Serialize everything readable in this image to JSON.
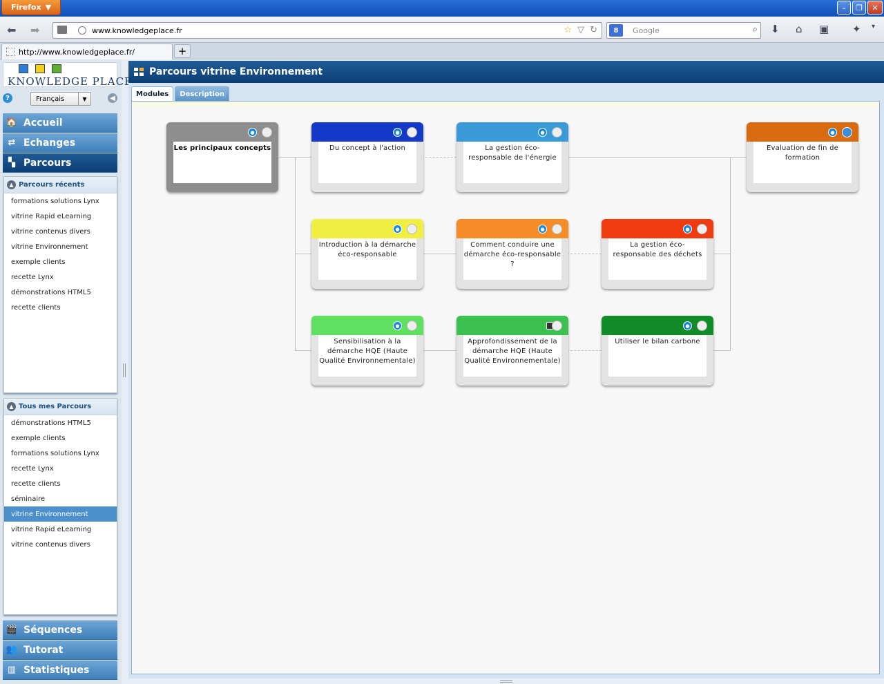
{
  "browser": {
    "menu_label": "Firefox",
    "url": "www.knowledgeplace.fr",
    "search_placeholder": "Google",
    "search_engine_icon": "google-icon",
    "tab_title": "http://www.knowledgeplace.fr/"
  },
  "app": {
    "logo_text": "KNOWLEDGE PLACE",
    "language": "Français",
    "menu": [
      {
        "label": "Accueil",
        "icon": "home-icon"
      },
      {
        "label": "Echanges",
        "icon": "exchange-icon"
      },
      {
        "label": "Parcours",
        "icon": "parcours-icon"
      }
    ],
    "recent": {
      "title": "Parcours récents",
      "items": [
        "formations solutions Lynx",
        "vitrine Rapid eLearning",
        "vitrine contenus divers",
        "vitrine Environnement",
        "exemple clients",
        "recette Lynx",
        "démonstrations HTML5",
        "recette clients"
      ]
    },
    "all": {
      "title": "Tous mes Parcours",
      "items": [
        "démonstrations HTML5",
        "exemple clients",
        "formations solutions Lynx",
        "recette Lynx",
        "recette clients",
        "séminaire",
        "vitrine Environnement",
        "vitrine Rapid eLearning",
        "vitrine contenus divers"
      ],
      "selected_index": 6
    },
    "bottom_menu": [
      {
        "label": "Séquences",
        "icon": "sequences-icon"
      },
      {
        "label": "Tutorat",
        "icon": "tutorat-icon"
      },
      {
        "label": "Statistiques",
        "icon": "statistics-icon"
      }
    ]
  },
  "main": {
    "title": "Parcours vitrine Environnement",
    "tabs": [
      "Modules",
      "Description"
    ],
    "active_tab": "Modules",
    "modules": [
      {
        "label": "Les principaux concepts",
        "color": "#8e8e8e",
        "status": "user"
      },
      {
        "label": "Du concept à l'action",
        "color": "#1438c8",
        "status": "user"
      },
      {
        "label": "La gestion éco-responsable de l'énergie",
        "color": "#3a9ad8",
        "status": "user"
      },
      {
        "label": "Evaluation de fin de formation",
        "color": "#d86a10",
        "status": "user"
      },
      {
        "label": "Introduction à la démarche éco-responsable",
        "color": "#f0ee40",
        "status": "user"
      },
      {
        "label": "Comment conduire une démarche éco-responsable ?",
        "color": "#f58c28",
        "status": "user"
      },
      {
        "label": "La gestion éco-responsable des déchets",
        "color": "#f03a10",
        "status": "user"
      },
      {
        "label": "Sensibilisation à la démarche HQE (Haute Qualité Environnementale)",
        "color": "#60e060",
        "status": "user"
      },
      {
        "label": "Approfondissement de la démarche HQE (Haute Qualité Environnementale)",
        "color": "#3cc050",
        "status": "locked"
      },
      {
        "label": "Utiliser le bilan carbone",
        "color": "#128c28",
        "status": "user"
      }
    ]
  }
}
